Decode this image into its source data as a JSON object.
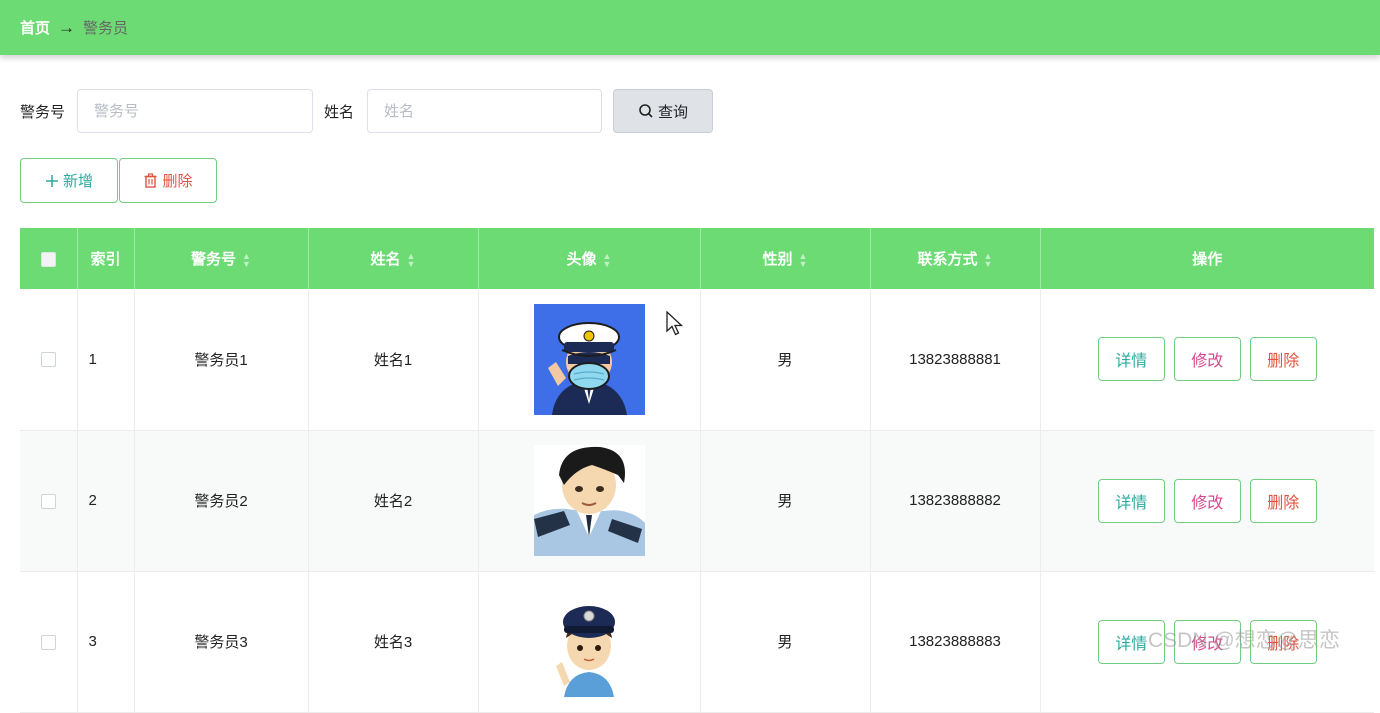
{
  "breadcrumb": {
    "home": "首页",
    "separator": "→",
    "current": "警务员"
  },
  "search": {
    "badge_label": "警务号",
    "badge_placeholder": "警务号",
    "name_label": "姓名",
    "name_placeholder": "姓名",
    "query_label": "查询",
    "query_icon": "search-icon"
  },
  "toolbar": {
    "add_label": "新增",
    "add_icon": "plus-icon",
    "delete_label": "删除",
    "delete_icon": "trash-icon"
  },
  "table": {
    "columns": [
      "",
      "索引",
      "警务号",
      "姓名",
      "头像",
      "性别",
      "联系方式",
      "操作"
    ],
    "sortable": [
      false,
      false,
      true,
      true,
      true,
      true,
      true,
      false
    ],
    "rows": [
      {
        "index": "1",
        "badge": "警务员1",
        "name": "姓名1",
        "avatar": "police-avatar-1",
        "gender": "男",
        "phone": "13823888881"
      },
      {
        "index": "2",
        "badge": "警务员2",
        "name": "姓名2",
        "avatar": "police-avatar-2",
        "gender": "男",
        "phone": "13823888882"
      },
      {
        "index": "3",
        "badge": "警务员3",
        "name": "姓名3",
        "avatar": "police-avatar-3",
        "gender": "男",
        "phone": "13823888883"
      }
    ],
    "row_actions": {
      "detail": "详情",
      "edit": "修改",
      "delete": "删除"
    }
  },
  "watermark": "CSDN @想恋@思恋",
  "colors": {
    "header_green": "#6cdb74",
    "button_border": "#72cf82",
    "detail": "#2ba9a0",
    "edit": "#d64a8c",
    "delete": "#e0533f"
  }
}
